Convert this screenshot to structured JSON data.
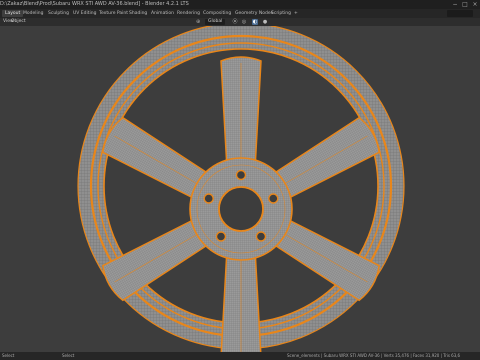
{
  "window": {
    "title": "D:\\Zakaz\\Blend\\Prod\\Subaru WRX STI AWD AV-36.blend] - Blender 4.2.1 LTS",
    "controls": [
      "−",
      "□",
      "×"
    ]
  },
  "workspaces": [
    {
      "label": "Layout",
      "active": true
    },
    {
      "label": "Modeling"
    },
    {
      "label": "Sculpting"
    },
    {
      "label": "UV Editing"
    },
    {
      "label": "Texture Paint"
    },
    {
      "label": "Shading"
    },
    {
      "label": "Animation"
    },
    {
      "label": "Rendering"
    },
    {
      "label": "Compositing"
    },
    {
      "label": "Geometry Nodes"
    },
    {
      "label": "Scripting"
    },
    {
      "label": "+"
    }
  ],
  "viewport_header": {
    "menus": [
      "View",
      "Object"
    ],
    "orientation": "Global",
    "icons": [
      "pivot-icon",
      "snap-icon",
      "proportional-icon",
      "overlay-icon",
      "shading-icon"
    ]
  },
  "statusbar": {
    "left": "Select",
    "middle": "Select",
    "right": "Scene_elements | Subaru WRX STI AWD AV-36 | Verts 35,476 | Faces 31,920 | Tris 63,6"
  },
  "colors": {
    "wire_orange": "#e8861a",
    "face_gray": "#8f8f8f",
    "viewport_bg": "#3d3d3d"
  }
}
